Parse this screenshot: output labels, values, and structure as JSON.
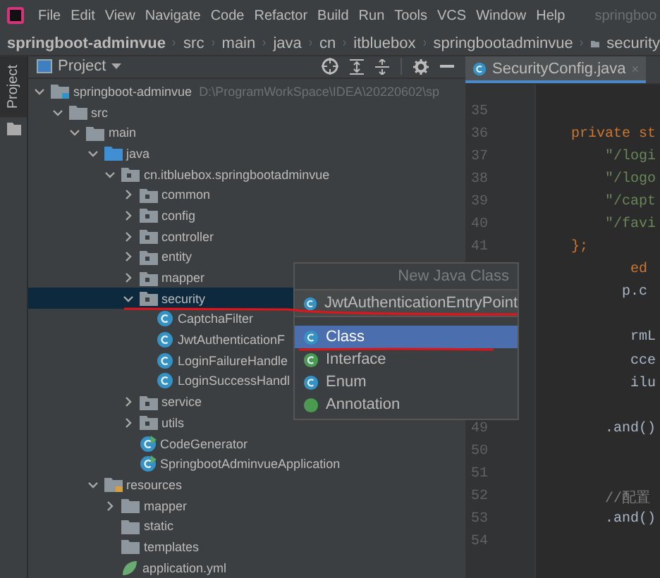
{
  "menu": {
    "items": [
      "File",
      "Edit",
      "View",
      "Navigate",
      "Code",
      "Refactor",
      "Build",
      "Run",
      "Tools",
      "VCS",
      "Window",
      "Help"
    ],
    "title": "springboo"
  },
  "breadcrumb": {
    "root": "springboot-adminvue",
    "parts": [
      "src",
      "main",
      "java",
      "cn",
      "itbluebox",
      "springbootadminvue"
    ],
    "current": "security"
  },
  "side_tab": {
    "label": "Project",
    "selected": true
  },
  "project": {
    "title": "Project",
    "tree": [
      {
        "label": "springboot-adminvue",
        "path": "D:\\ProgramWorkSpace\\IDEA\\20220602\\sp",
        "kind": "module",
        "expanded": true,
        "selected": false,
        "children": [
          {
            "label": "src",
            "kind": "folder",
            "expanded": true,
            "selected": false,
            "children": [
              {
                "label": "main",
                "kind": "folder",
                "expanded": true,
                "selected": false,
                "children": [
                  {
                    "label": "java",
                    "kind": "source-folder",
                    "expanded": true,
                    "selected": false,
                    "children": [
                      {
                        "label": "cn.itbluebox.springbootadminvue",
                        "kind": "package",
                        "expanded": true,
                        "selected": false,
                        "children": [
                          {
                            "label": "common",
                            "kind": "package",
                            "expanded": false,
                            "selected": false
                          },
                          {
                            "label": "config",
                            "kind": "package",
                            "expanded": false,
                            "selected": false
                          },
                          {
                            "label": "controller",
                            "kind": "package",
                            "expanded": false,
                            "selected": false
                          },
                          {
                            "label": "entity",
                            "kind": "package",
                            "expanded": false,
                            "selected": false
                          },
                          {
                            "label": "mapper",
                            "kind": "package",
                            "expanded": false,
                            "selected": false
                          },
                          {
                            "label": "security",
                            "kind": "package",
                            "expanded": true,
                            "selected": true,
                            "children": [
                              {
                                "label": "CaptchaFilter",
                                "kind": "class",
                                "selected": false
                              },
                              {
                                "label": "JwtAuthenticationF",
                                "kind": "class",
                                "selected": false
                              },
                              {
                                "label": "LoginFailureHandle",
                                "kind": "class",
                                "selected": false
                              },
                              {
                                "label": "LoginSuccessHandl",
                                "kind": "class",
                                "selected": false
                              }
                            ]
                          },
                          {
                            "label": "service",
                            "kind": "package",
                            "expanded": false,
                            "selected": false
                          },
                          {
                            "label": "utils",
                            "kind": "package",
                            "expanded": false,
                            "selected": false
                          },
                          {
                            "label": "CodeGenerator",
                            "kind": "runnable-class",
                            "selected": false
                          },
                          {
                            "label": "SpringbootAdminvueApplication",
                            "kind": "spring-class",
                            "selected": false
                          }
                        ]
                      }
                    ]
                  },
                  {
                    "label": "resources",
                    "kind": "resource-folder",
                    "expanded": true,
                    "selected": false,
                    "children": [
                      {
                        "label": "mapper",
                        "kind": "folder",
                        "expanded": false,
                        "selected": false
                      },
                      {
                        "label": "static",
                        "kind": "folder",
                        "selected": false
                      },
                      {
                        "label": "templates",
                        "kind": "folder",
                        "selected": false
                      },
                      {
                        "label": "application.yml",
                        "kind": "yml",
                        "selected": false
                      }
                    ]
                  }
                ]
              }
            ]
          }
        ]
      }
    ]
  },
  "editor": {
    "tab": {
      "label": "SecurityConfig.java",
      "close": "×",
      "selected": true
    },
    "lines": [
      {
        "number": "35"
      },
      {
        "number": "36",
        "text": "    private st",
        "kind": "keyword"
      },
      {
        "number": "37",
        "text": "        \"/logi",
        "kind": "string"
      },
      {
        "number": "38",
        "text": "        \"/logo",
        "kind": "string"
      },
      {
        "number": "39",
        "text": "        \"/capt",
        "kind": "string"
      },
      {
        "number": "40",
        "text": "        \"/favi",
        "kind": "string"
      },
      {
        "number": "41",
        "text": "    };",
        "kind": "keyword"
      },
      {
        "text": "           ed",
        "kind": "keyword"
      },
      {
        "text": "          p.c",
        "kind": "plain"
      },
      {
        "text": "           rmL",
        "kind": "plain",
        "gap_before": true
      },
      {
        "text": "           cce",
        "kind": "plain"
      },
      {
        "text": "           ilu",
        "kind": "plain"
      },
      {
        "number": "49",
        "text": "        .and()",
        "kind": "plain",
        "gap_before": true
      },
      {
        "number": "50"
      },
      {
        "number": "51"
      },
      {
        "number": "52",
        "text": "        //配置",
        "kind": "comment"
      },
      {
        "number": "53",
        "text": "        .and()",
        "kind": "plain"
      },
      {
        "number": "54"
      }
    ]
  },
  "popup": {
    "title": "New Java Class",
    "name_value": "JwtAuthenticationEntryPoint",
    "items": [
      {
        "label": "Class",
        "kind": "class",
        "selected": true
      },
      {
        "label": "Interface",
        "kind": "interface",
        "selected": false
      },
      {
        "label": "Enum",
        "kind": "enum",
        "selected": false
      },
      {
        "label": "Annotation",
        "kind": "annotation",
        "selected": false
      }
    ]
  }
}
